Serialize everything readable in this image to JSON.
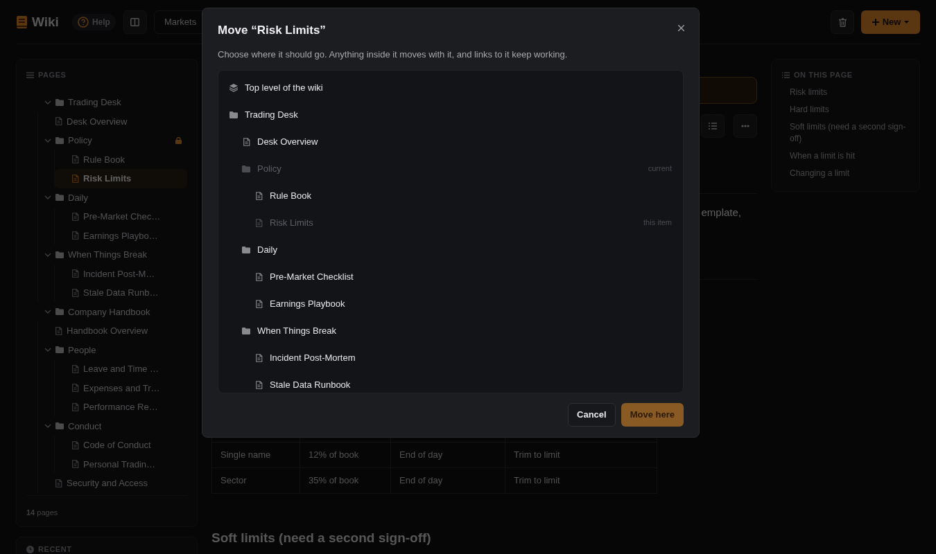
{
  "header": {
    "logo_text": "Wiki",
    "help": "Help",
    "breadcrumb": "Markets",
    "new_button": "New"
  },
  "sidebar": {
    "title": "PAGES",
    "tree": [
      {
        "kind": "folder",
        "label": "Trading Desk",
        "expanded": true,
        "children": [
          {
            "kind": "page",
            "label": "Desk Overview",
            "selected": false
          },
          {
            "kind": "folder",
            "label": "Policy",
            "expanded": true,
            "locked": true,
            "children": [
              {
                "kind": "page",
                "label": "Rule Book",
                "selected": false
              },
              {
                "kind": "page",
                "label": "Risk Limits",
                "selected": true
              }
            ]
          },
          {
            "kind": "folder",
            "label": "Daily",
            "expanded": true,
            "children": [
              {
                "kind": "page",
                "label": "Pre-Market Chec…",
                "selected": false
              },
              {
                "kind": "page",
                "label": "Earnings Playbo…",
                "selected": false
              }
            ]
          },
          {
            "kind": "folder",
            "label": "When Things Break",
            "expanded": true,
            "children": [
              {
                "kind": "page",
                "label": "Incident Post-M…",
                "selected": false
              },
              {
                "kind": "page",
                "label": "Stale Data Runb…",
                "selected": false
              }
            ]
          }
        ]
      },
      {
        "kind": "folder",
        "label": "Company Handbook",
        "expanded": true,
        "children": [
          {
            "kind": "page",
            "label": "Handbook Overview",
            "selected": false
          },
          {
            "kind": "folder",
            "label": "People",
            "expanded": true,
            "children": [
              {
                "kind": "page",
                "label": "Leave and Time …",
                "selected": false
              },
              {
                "kind": "page",
                "label": "Expenses and Tr…",
                "selected": false
              },
              {
                "kind": "page",
                "label": "Performance Re…",
                "selected": false
              }
            ]
          },
          {
            "kind": "folder",
            "label": "Conduct",
            "expanded": true,
            "children": [
              {
                "kind": "page",
                "label": "Code of Conduct",
                "selected": false
              },
              {
                "kind": "page",
                "label": "Personal Tradin…",
                "selected": false
              }
            ]
          },
          {
            "kind": "page",
            "label": "Security and Access",
            "selected": false
          }
        ]
      }
    ],
    "count": "14",
    "count_label": "pages",
    "recent_title": "RECENT"
  },
  "content": {
    "paragraph_fragment": "emplate,",
    "table_rows": [
      [
        "Single name",
        "12% of book",
        "End of day",
        "Trim to limit"
      ],
      [
        "Sector",
        "35% of book",
        "End of day",
        "Trim to limit"
      ]
    ],
    "heading": "Soft limits (need a second sign-off)"
  },
  "toc": {
    "title": "ON THIS PAGE",
    "items": [
      "Risk limits",
      "Hard limits",
      "Soft limits (need a second sign-off)",
      "When a limit is hit",
      "Changing a limit"
    ]
  },
  "modal": {
    "title": "Move “Risk Limits”",
    "description": "Choose where it should go. Anything inside it moves with it, and links to it keep working.",
    "destinations": [
      {
        "kind": "root",
        "label": "Top level of the wiki",
        "disabled": false
      },
      {
        "kind": "folder",
        "label": "Trading Desk",
        "disabled": false,
        "children": [
          {
            "kind": "page",
            "label": "Desk Overview",
            "disabled": false
          },
          {
            "kind": "folder",
            "label": "Policy",
            "disabled": true,
            "note": "current",
            "children": [
              {
                "kind": "page",
                "label": "Rule Book",
                "disabled": false
              },
              {
                "kind": "page",
                "label": "Risk Limits",
                "disabled": true,
                "note": "this item"
              }
            ]
          },
          {
            "kind": "folder",
            "label": "Daily",
            "disabled": false,
            "children": [
              {
                "kind": "page",
                "label": "Pre-Market Checklist",
                "disabled": false
              },
              {
                "kind": "page",
                "label": "Earnings Playbook",
                "disabled": false
              }
            ]
          },
          {
            "kind": "folder",
            "label": "When Things Break",
            "disabled": false,
            "children": [
              {
                "kind": "page",
                "label": "Incident Post-Mortem",
                "disabled": false
              },
              {
                "kind": "page",
                "label": "Stale Data Runbook",
                "disabled": false
              }
            ]
          }
        ]
      }
    ],
    "cancel": "Cancel",
    "confirm": "Move here"
  }
}
